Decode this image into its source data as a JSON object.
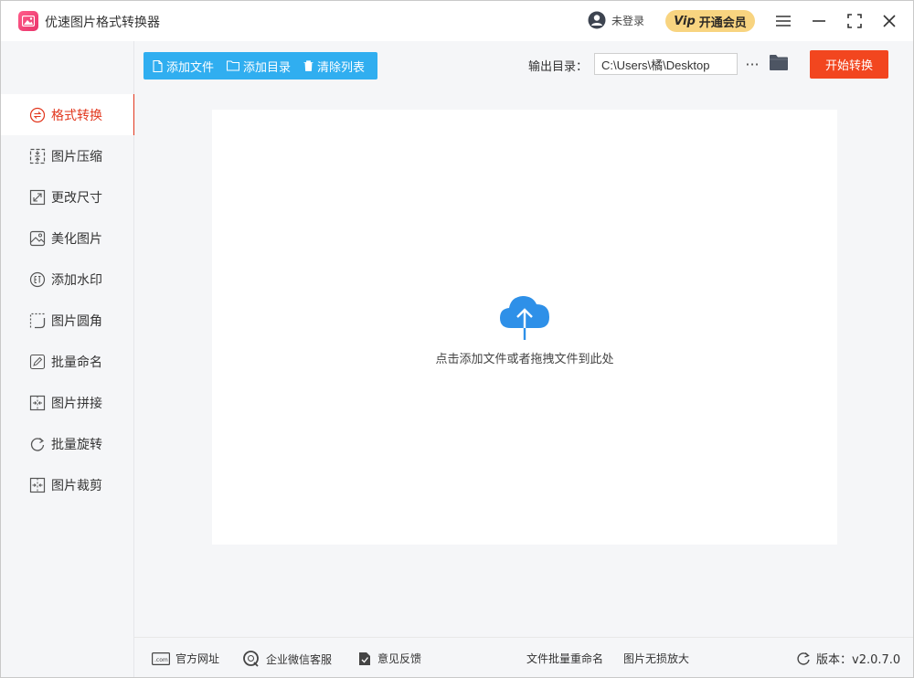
{
  "app": {
    "title": "优速图片格式转换器"
  },
  "header": {
    "user_label": "未登录",
    "vip_badge": "Vip",
    "vip_label": "开通会员"
  },
  "toolbar": {
    "add_file": "添加文件",
    "add_folder": "添加目录",
    "clear_list": "清除列表",
    "output_label": "输出目录：",
    "output_path": "C:\\Users\\橘\\Desktop",
    "more": "···",
    "start": "开始转换"
  },
  "sidebar": {
    "items": [
      {
        "label": "格式转换",
        "icon": "convert-icon",
        "active": true
      },
      {
        "label": "图片压缩",
        "icon": "compress-icon"
      },
      {
        "label": "更改尺寸",
        "icon": "resize-icon"
      },
      {
        "label": "美化图片",
        "icon": "beautify-icon"
      },
      {
        "label": "添加水印",
        "icon": "watermark-icon"
      },
      {
        "label": "图片圆角",
        "icon": "rounded-corner-icon"
      },
      {
        "label": "批量命名",
        "icon": "rename-icon"
      },
      {
        "label": "图片拼接",
        "icon": "stitch-icon"
      },
      {
        "label": "批量旋转",
        "icon": "rotate-icon"
      },
      {
        "label": "图片裁剪",
        "icon": "crop-icon"
      }
    ]
  },
  "main": {
    "drop_hint": "点击添加文件或者拖拽文件到此处"
  },
  "footer": {
    "website": "官方网址",
    "wechat": "企业微信客服",
    "feedback": "意见反馈",
    "batch_rename": "文件批量重命名",
    "lossless_zoom": "图片无损放大",
    "version": "版本：v2.0.7.0",
    "website_icon_text": ".com"
  },
  "colors": {
    "accent": "#e2371e",
    "toolbar_blue": "#30aef0",
    "start_red": "#f2461f",
    "upload_blue": "#2e90e8",
    "vip_gold": "#f8d480"
  }
}
